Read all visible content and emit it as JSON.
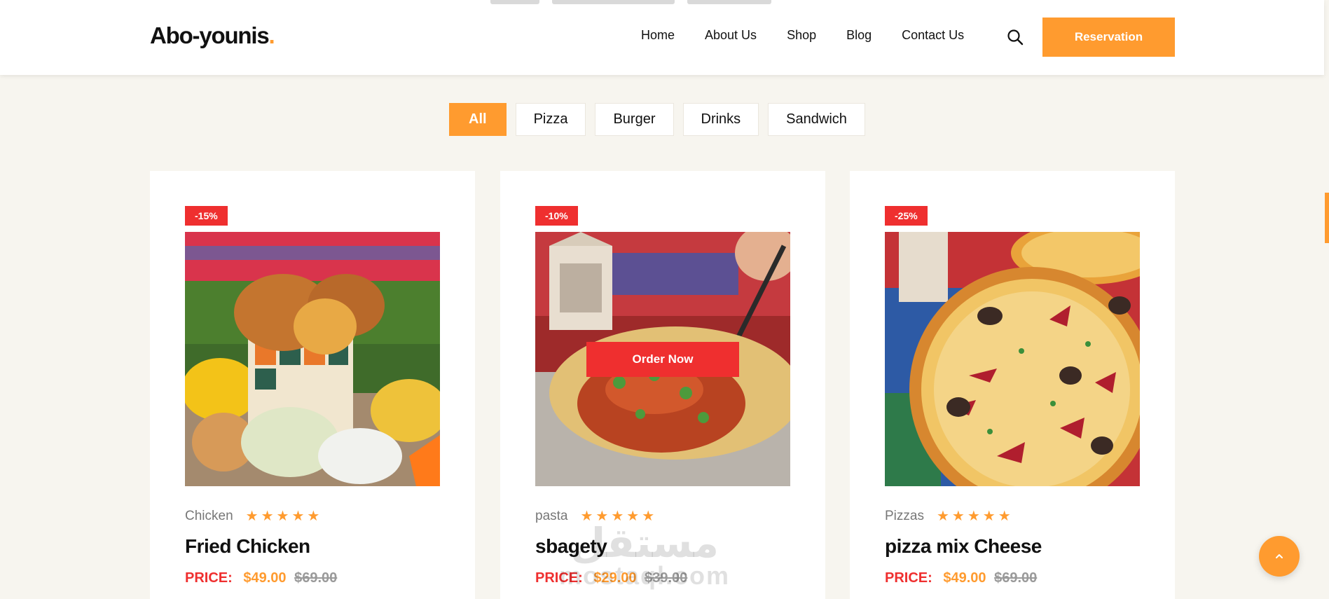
{
  "brand": {
    "name": "Abo-younis",
    "dot": ".",
    "accent": "#ff9b2f"
  },
  "nav": {
    "items": [
      "Home",
      "About Us",
      "Shop",
      "Blog",
      "Contact Us"
    ],
    "search_icon": "search-icon",
    "reservation_label": "Reservation"
  },
  "filters": {
    "items": [
      "All",
      "Pizza",
      "Burger",
      "Drinks",
      "Sandwich"
    ],
    "active": "All"
  },
  "products": [
    {
      "discount": "-15%",
      "category": "Chicken",
      "name": "Fried Chicken",
      "price_label": "PRICE:",
      "price": "$49.00",
      "old_price": "$69.00",
      "rating": 5,
      "stars": "★★★★★"
    },
    {
      "discount": "-10%",
      "category": "pasta",
      "name": "sbagety",
      "price_label": "PRICE:",
      "price": "$29.00",
      "old_price": "$39.00",
      "rating": 5,
      "stars": "★★★★★",
      "order_label": "Order Now"
    },
    {
      "discount": "-25%",
      "category": "Pizzas",
      "name": "pizza mix Cheese",
      "price_label": "PRICE:",
      "price": "$49.00",
      "old_price": "$69.00",
      "rating": 5,
      "stars": "★★★★★"
    }
  ],
  "watermark": {
    "arabic": "مستقل",
    "latin": "mostaql.com"
  },
  "colors": {
    "accent": "#ff9b2f",
    "sale": "#ef2f2f",
    "background": "#f7f5ef"
  },
  "back_to_top_icon": "chevron-up-icon"
}
